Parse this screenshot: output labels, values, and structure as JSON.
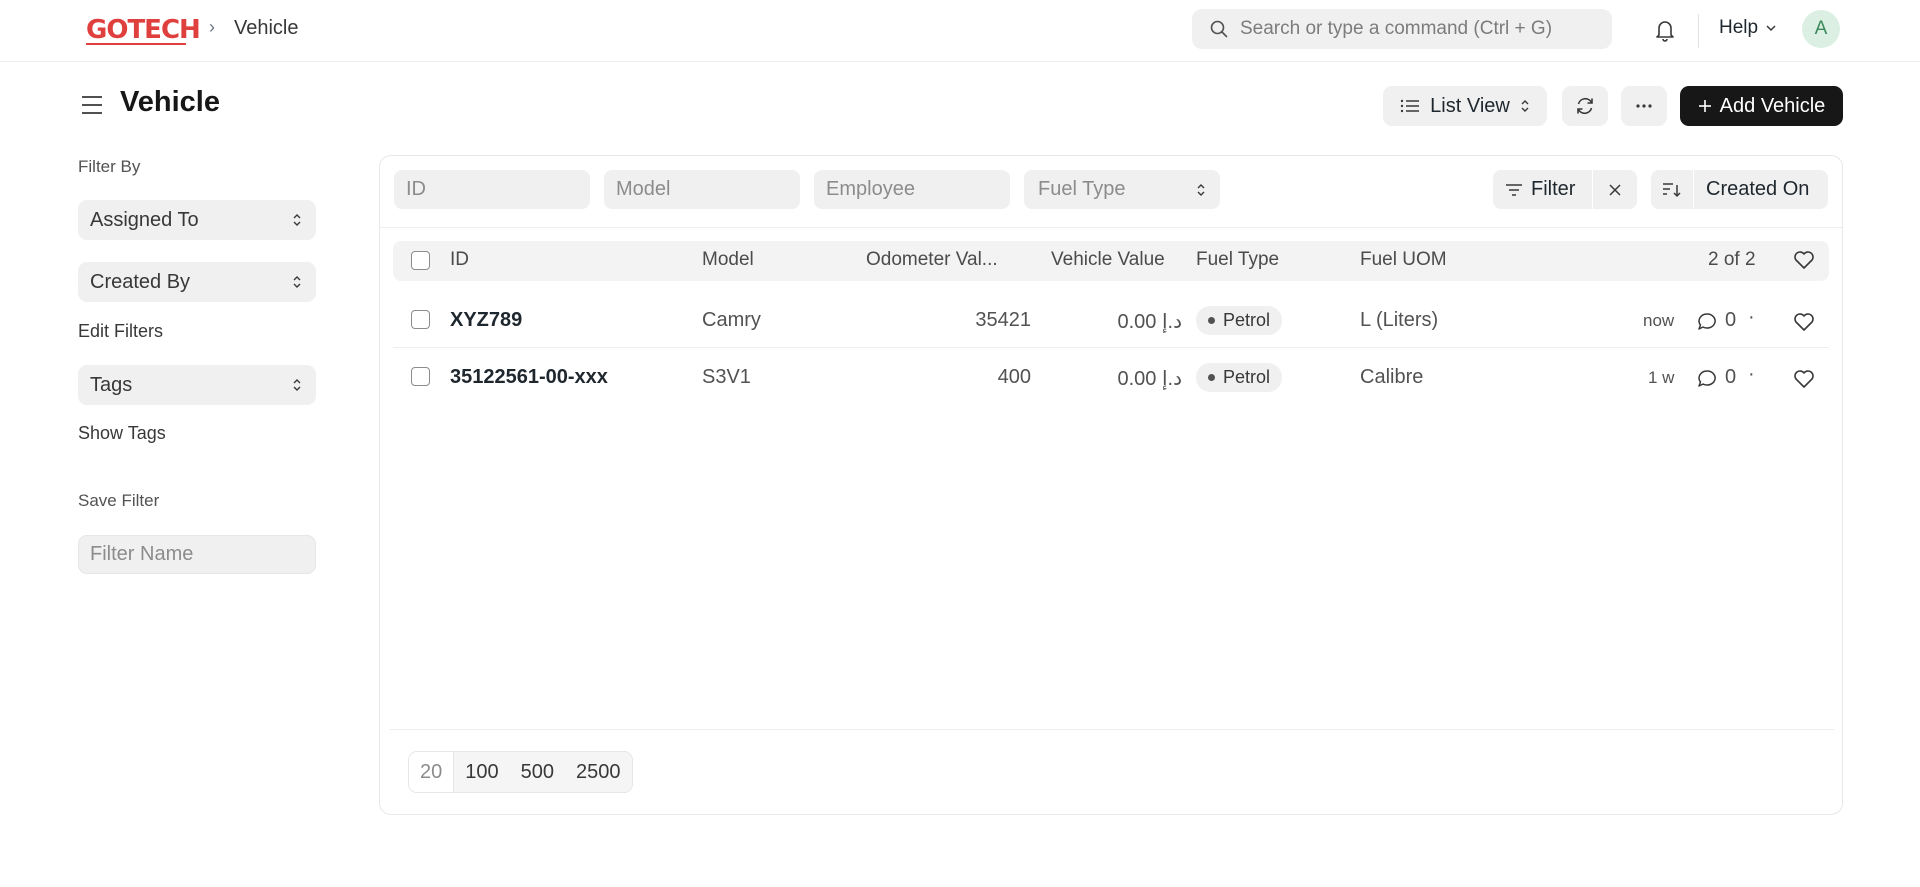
{
  "navbar": {
    "logo_text": "GOTECH",
    "breadcrumb": "Vehicle",
    "search_placeholder": "Search or type a command (Ctrl + G)",
    "help_label": "Help",
    "avatar_initial": "A"
  },
  "page": {
    "title": "Vehicle",
    "list_view_label": "List View",
    "add_button_label": "Add Vehicle"
  },
  "sidebar": {
    "filter_by_label": "Filter By",
    "assigned_to_label": "Assigned To",
    "created_by_label": "Created By",
    "edit_filters_label": "Edit Filters",
    "tags_label": "Tags",
    "show_tags_label": "Show Tags",
    "save_filter_label": "Save Filter",
    "filter_name_placeholder": "Filter Name"
  },
  "filters": {
    "id_placeholder": "ID",
    "model_placeholder": "Model",
    "employee_placeholder": "Employee",
    "fuel_type_label": "Fuel Type",
    "filter_label": "Filter",
    "sort_label": "Created On"
  },
  "table": {
    "columns": {
      "id": "ID",
      "model": "Model",
      "odometer": "Odometer Val...",
      "vehicle_value": "Vehicle Value",
      "fuel_type": "Fuel Type",
      "fuel_uom": "Fuel UOM"
    },
    "count": "2 of 2",
    "rows": [
      {
        "id": "XYZ789",
        "model": "Camry",
        "odometer": "35421",
        "vehicle_value": "د.إ 0.00",
        "fuel_type": "Petrol",
        "fuel_uom": "L (Liters)",
        "modified": "now",
        "comments": "0"
      },
      {
        "id": "35122561-00-xxx",
        "model": "S3V1",
        "odometer": "400",
        "vehicle_value": "د.إ 0.00",
        "fuel_type": "Petrol",
        "fuel_uom": "Calibre",
        "modified": "1 w",
        "comments": "0"
      }
    ]
  },
  "pagination": {
    "options": [
      "20",
      "100",
      "500",
      "2500"
    ]
  },
  "colors": {
    "brand": "#e0403d",
    "primary_button": "#171717",
    "avatar_bg": "#dcefe3"
  }
}
